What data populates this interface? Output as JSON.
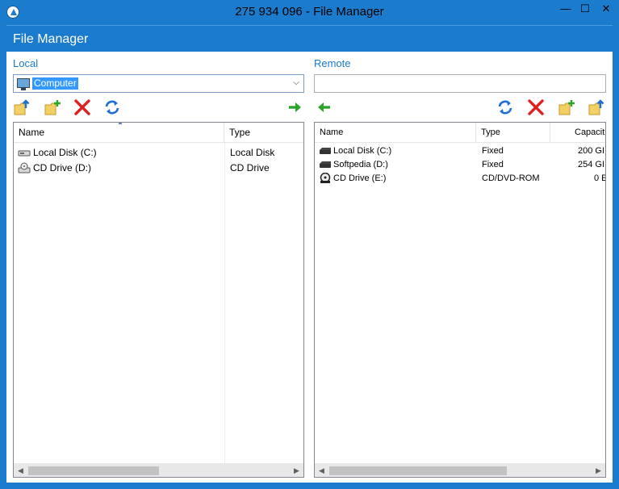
{
  "window": {
    "title": "275 934 096 - File Manager",
    "min_label": "—",
    "max_label": "☐",
    "close_label": "✕"
  },
  "header": {
    "title": "File Manager"
  },
  "local": {
    "label": "Local",
    "combo_value": "Computer",
    "columns": [
      "Name",
      "Type"
    ],
    "rows": [
      {
        "name": "Local Disk (C:)",
        "type": "Local Disk",
        "icon": "hard-drive-icon"
      },
      {
        "name": "CD Drive (D:)",
        "type": "CD Drive",
        "icon": "cd-drive-icon"
      }
    ],
    "toolbar": [
      "folder-up-icon",
      "new-folder-icon",
      "delete-icon",
      "refresh-icon",
      "transfer-right-icon"
    ]
  },
  "remote": {
    "label": "Remote",
    "combo_value": "",
    "columns": [
      "Name",
      "Type",
      "Capacit"
    ],
    "rows": [
      {
        "name": "Local Disk (C:)",
        "type": "Fixed",
        "capacity": "200 GI",
        "icon": "hard-drive-icon"
      },
      {
        "name": "Softpedia (D:)",
        "type": "Fixed",
        "capacity": "254 GI",
        "icon": "hard-drive-icon"
      },
      {
        "name": "CD Drive (E:)",
        "type": "CD/DVD-ROM",
        "capacity": "0 E",
        "icon": "cd-drive-icon"
      }
    ],
    "toolbar": [
      "transfer-left-icon",
      "refresh-icon",
      "delete-icon",
      "new-folder-icon",
      "folder-up-icon"
    ]
  },
  "colors": {
    "accent": "#1b7bcc",
    "arrow_green": "#2aa52a",
    "delete_red": "#e02020",
    "refresh_blue": "#1e6fd0",
    "folder_yellow": "#f2cf63"
  }
}
